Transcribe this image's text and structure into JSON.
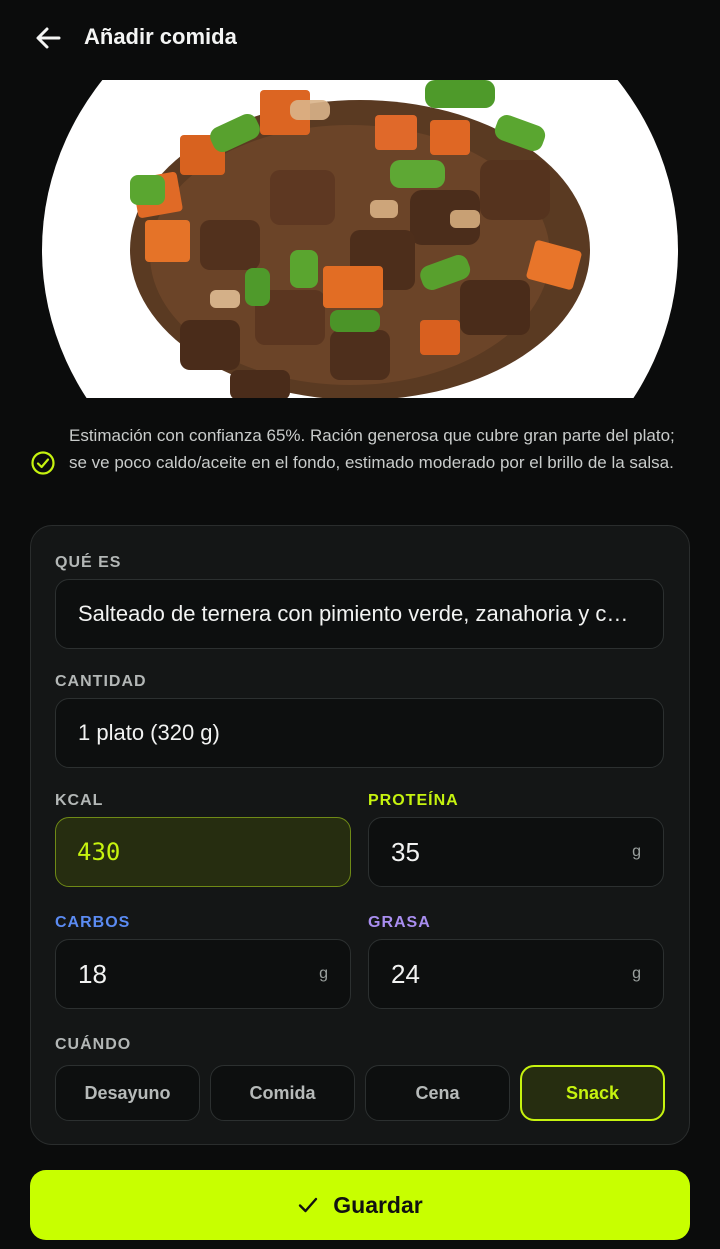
{
  "header": {
    "title": "Añadir comida",
    "back_icon": "arrow-left-icon"
  },
  "photo": {
    "subject": "food-photo"
  },
  "estimate": {
    "icon": "check-circle-icon",
    "text": "Estimación con confianza 65%. Ración generosa que cubre gran parte del plato; se ve poco caldo/aceite en el fondo, estimado moderado por el brillo de la salsa."
  },
  "form": {
    "what_label": "QUÉ ES",
    "what_value": "Salteado de ternera con pimiento verde, zanahoria y cebolla",
    "quantity_label": "CANTIDAD",
    "quantity_value": "1 plato (320 g)",
    "kcal_label": "KCAL",
    "kcal_value": "430",
    "protein_label": "PROTEÍNA",
    "protein_value": "35",
    "protein_unit": "g",
    "carbs_label": "CARBOS",
    "carbs_value": "18",
    "carbs_unit": "g",
    "fat_label": "GRASA",
    "fat_value": "24",
    "fat_unit": "g",
    "when_label": "CUÁNDO",
    "when_options": [
      "Desayuno",
      "Comida",
      "Cena",
      "Snack"
    ],
    "when_selected": "Snack"
  },
  "save": {
    "label": "Guardar",
    "icon": "check-icon"
  },
  "colors": {
    "accent": "#c8ff00",
    "protein": "#c6f30f",
    "carbs": "#5b8bf2",
    "fat": "#a98ef0",
    "background": "#0b0c0c"
  }
}
